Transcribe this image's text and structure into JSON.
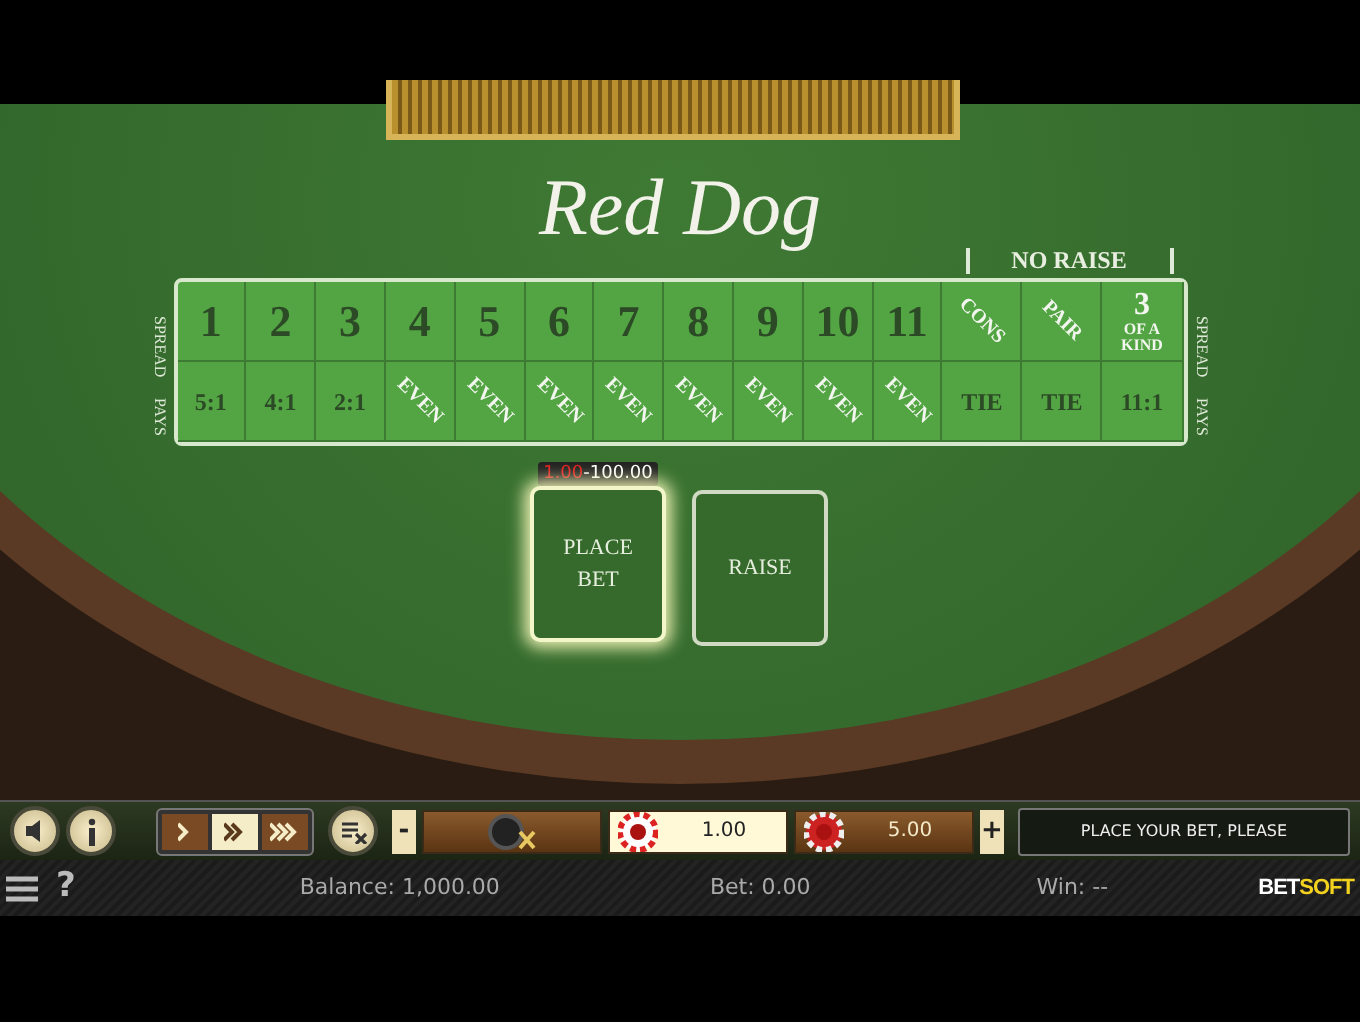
{
  "title": "Red Dog",
  "board": {
    "header": "NO RAISE",
    "left_labels": [
      "SPREAD",
      "PAYS"
    ],
    "right_labels": [
      "SPREAD",
      "PAYS"
    ],
    "spread_row": [
      {
        "kind": "number",
        "label": "1"
      },
      {
        "kind": "number",
        "label": "2"
      },
      {
        "kind": "number",
        "label": "3"
      },
      {
        "kind": "number",
        "label": "4"
      },
      {
        "kind": "number",
        "label": "5"
      },
      {
        "kind": "number",
        "label": "6"
      },
      {
        "kind": "number",
        "label": "7"
      },
      {
        "kind": "number",
        "label": "8"
      },
      {
        "kind": "number",
        "label": "9"
      },
      {
        "kind": "number",
        "label": "10"
      },
      {
        "kind": "number",
        "label": "11"
      },
      {
        "kind": "diagonal",
        "label": "CONS"
      },
      {
        "kind": "diagonal",
        "label": "PAIR"
      },
      {
        "kind": "stacked",
        "label": "3",
        "sub": "OF A KIND"
      }
    ],
    "pays_row": [
      {
        "kind": "plain",
        "label": "5:1"
      },
      {
        "kind": "plain",
        "label": "4:1"
      },
      {
        "kind": "plain",
        "label": "2:1"
      },
      {
        "kind": "diagonal",
        "label": "EVEN"
      },
      {
        "kind": "diagonal",
        "label": "EVEN"
      },
      {
        "kind": "diagonal",
        "label": "EVEN"
      },
      {
        "kind": "diagonal",
        "label": "EVEN"
      },
      {
        "kind": "diagonal",
        "label": "EVEN"
      },
      {
        "kind": "diagonal",
        "label": "EVEN"
      },
      {
        "kind": "diagonal",
        "label": "EVEN"
      },
      {
        "kind": "diagonal",
        "label": "EVEN"
      },
      {
        "kind": "plain",
        "label": "TIE"
      },
      {
        "kind": "plain",
        "label": "TIE"
      },
      {
        "kind": "plain",
        "label": "11:1"
      }
    ]
  },
  "bet_range": {
    "min": "1.00",
    "separator": "-",
    "max": "100.00"
  },
  "bet_spots": [
    {
      "label": "PLACE BET",
      "active": true
    },
    {
      "label": "RAISE",
      "active": false
    }
  ],
  "toolbar": {
    "speed": [
      {
        "kind": "single",
        "selected": false
      },
      {
        "kind": "double",
        "selected": true
      },
      {
        "kind": "triple",
        "selected": false
      }
    ],
    "minus": "-",
    "chips": [
      {
        "kind": "clear",
        "selected": false
      },
      {
        "kind": "chip",
        "value": "1.00",
        "selected": true
      },
      {
        "kind": "chip",
        "value": "5.00",
        "selected": false
      }
    ],
    "plus": "+",
    "message": "PLACE YOUR BET, PLEASE"
  },
  "status_bar": {
    "help": "?",
    "balance": "Balance: 1,000.00",
    "bet": "Bet: 0.00",
    "win": "Win: --",
    "logo": [
      "BET",
      "SOFT"
    ]
  }
}
